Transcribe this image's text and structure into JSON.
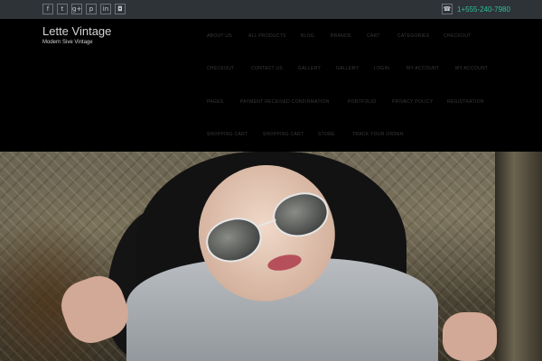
{
  "topbar": {
    "social": [
      {
        "icon": "facebook-icon",
        "glyph": "f"
      },
      {
        "icon": "twitter-icon",
        "glyph": "t"
      },
      {
        "icon": "google-plus-icon",
        "glyph": "g+"
      },
      {
        "icon": "pinterest-icon",
        "glyph": "p"
      },
      {
        "icon": "linkedin-icon",
        "glyph": "in"
      },
      {
        "icon": "instagram-icon",
        "glyph": "◘"
      }
    ],
    "phone_icon": "phone-icon",
    "phone": "1+555-240-7980"
  },
  "site": {
    "title": "Lette Vintage",
    "tagline": "Modern Sive Vintage"
  },
  "nav": [
    [
      "ABOUT US",
      "ALL PRODUCTS",
      "BLOG",
      "BRANDS",
      "CART",
      "CATEGORIES",
      "CHECKOUT"
    ],
    [
      "CHECKOUT",
      "CONTACT US",
      "GALLERY",
      "GALLERY",
      "LOGIN",
      "MY ACCOUNT",
      "MY ACCOUNT"
    ],
    [
      "PAGES",
      "PAYMENT RECEIVED CONFIRMATION",
      "PORTFOLIO",
      "PRIVACY POLICY",
      "REGISTRATION"
    ],
    [
      "SHOPPING CART",
      "SHOPPING CART",
      "STORE",
      "TRACK YOUR ORDER"
    ]
  ],
  "colors": {
    "topbar_bg": "#2e3338",
    "accent": "#2fbf95",
    "header_bg": "#000000"
  }
}
